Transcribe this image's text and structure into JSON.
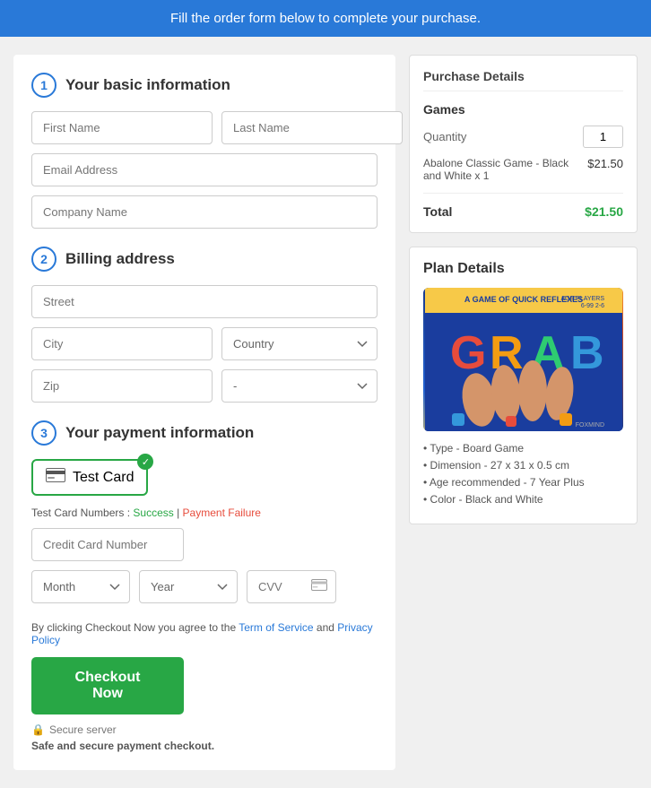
{
  "banner": {
    "text": "Fill the order form below to complete your purchase."
  },
  "sections": {
    "basic_info": {
      "number": "1",
      "title": "Your basic information"
    },
    "billing": {
      "number": "2",
      "title": "Billing address"
    },
    "payment": {
      "number": "3",
      "title": "Your payment information"
    }
  },
  "form": {
    "first_name_placeholder": "First Name",
    "last_name_placeholder": "Last Name",
    "email_placeholder": "Email Address",
    "company_placeholder": "Company Name",
    "street_placeholder": "Street",
    "city_placeholder": "City",
    "country_placeholder": "Country",
    "zip_placeholder": "Zip",
    "state_placeholder": "-",
    "card_name": "Test Card",
    "test_card_label": "Test Card Numbers :",
    "success_link": "Success",
    "failure_link": "Payment Failure",
    "credit_card_placeholder": "Credit Card Number",
    "month_placeholder": "Month",
    "year_placeholder": "Year",
    "cvv_placeholder": "CVV"
  },
  "tos": {
    "text_before": "By clicking Checkout Now you agree to the ",
    "tos_link": "Term of Service",
    "text_between": " and ",
    "privacy_link": "Privacy Policy"
  },
  "checkout": {
    "button_label": "Checkout Now",
    "secure_server": "Secure server",
    "safe_text": "Safe and secure payment checkout."
  },
  "purchase_details": {
    "title": "Purchase Details",
    "category": "Games",
    "quantity_label": "Quantity",
    "quantity_value": "1",
    "product_name": "Abalone Classic Game - Black and White x 1",
    "product_price": "$21.50",
    "total_label": "Total",
    "total_price": "$21.50"
  },
  "plan_details": {
    "title": "Plan Details",
    "specs": [
      "Type - Board Game",
      "Dimension - 27 x 31 x 0.5 cm",
      "Age recommended - 7 Year Plus",
      "Color - Black and White"
    ]
  }
}
